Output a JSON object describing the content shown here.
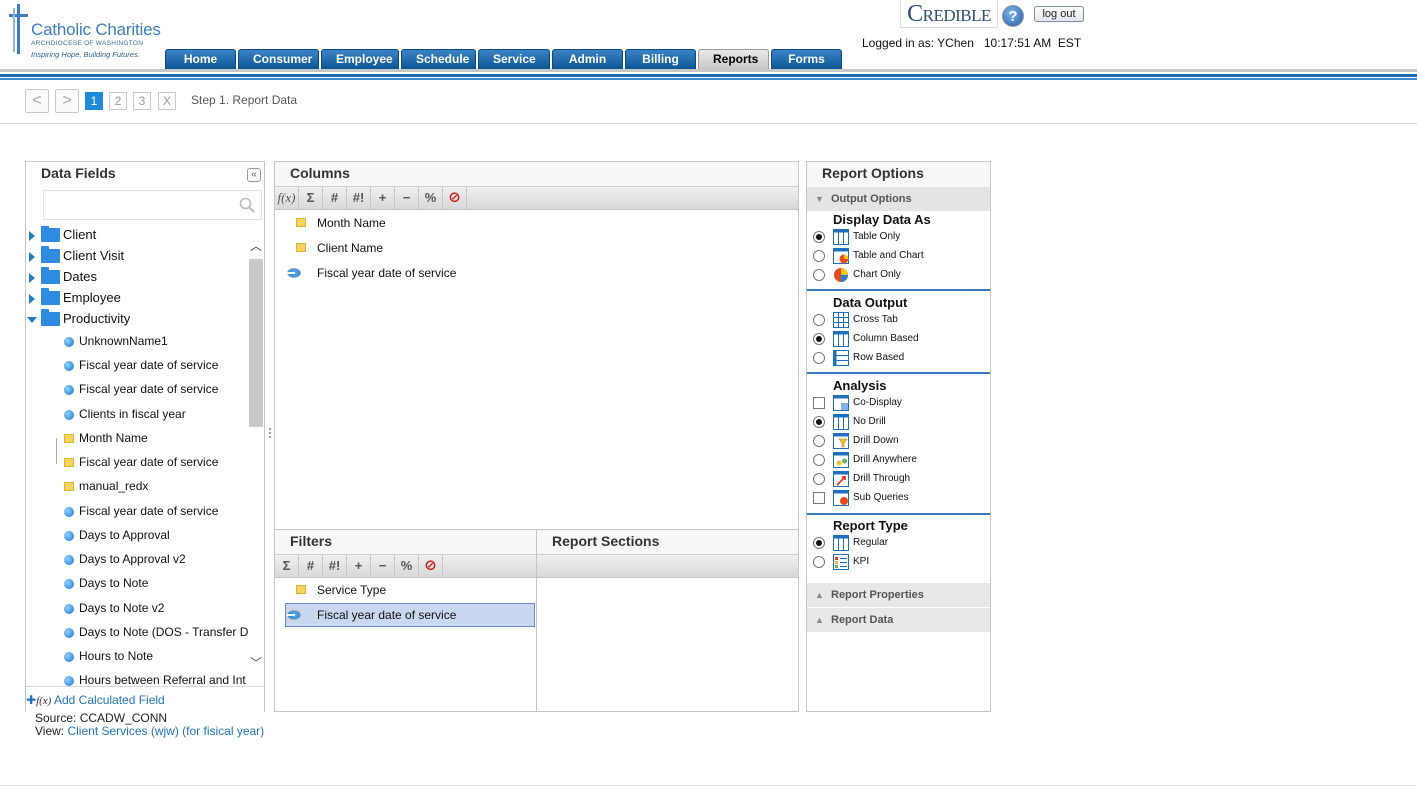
{
  "logo": {
    "line1": "Catholic Charities",
    "line2": "ARCHDIOCESE OF WASHINGTON",
    "line3": "Inspiring Hope, Building Futures."
  },
  "nav": {
    "tabs": [
      "Home",
      "Consumer",
      "Employee",
      "Schedule",
      "Service",
      "Admin",
      "Billing",
      "Reports",
      "Forms"
    ],
    "active": "Reports"
  },
  "header": {
    "brand": "Credible",
    "help": "?",
    "logout": "log out",
    "logged_in": "Logged in as: YChen   10:17:51 AM  EST"
  },
  "wizard": {
    "prev": "<",
    "next": ">",
    "steps": [
      "1",
      "2",
      "3",
      "X"
    ],
    "active_step": "1",
    "label": "Step 1. Report Data"
  },
  "data_fields": {
    "title": "Data Fields",
    "collapse": "«",
    "search_placeholder": "",
    "folders": [
      "Client",
      "Client Visit",
      "Dates",
      "Employee",
      "Productivity"
    ],
    "items": [
      {
        "label": "UnknownName1",
        "kind": "measure"
      },
      {
        "label": "Fiscal year date of service",
        "kind": "measure"
      },
      {
        "label": "Fiscal year date of service",
        "kind": "measure"
      },
      {
        "label": "Clients in fiscal year",
        "kind": "measure"
      },
      {
        "label": "Month Name",
        "kind": "dimension"
      },
      {
        "label": "Fiscal year date of service",
        "kind": "dimension"
      },
      {
        "label": "manual_redx",
        "kind": "dimension"
      },
      {
        "label": "Fiscal year date of service",
        "kind": "measure"
      },
      {
        "label": "Days to Approval",
        "kind": "measure"
      },
      {
        "label": "Days to Approval v2",
        "kind": "measure"
      },
      {
        "label": "Days to Note",
        "kind": "measure"
      },
      {
        "label": "Days to Note v2",
        "kind": "measure"
      },
      {
        "label": "Days to Note (DOS - Transfer D",
        "kind": "measure"
      },
      {
        "label": "Hours to Note",
        "kind": "measure"
      },
      {
        "label": "Hours between Referral and Int",
        "kind": "measure"
      }
    ],
    "add_calc": "Add Calculated Field",
    "add_calc_fx": "f(x)",
    "source": "Source: CCADW_CONN",
    "view_prefix": "View: ",
    "view_link": "Client Services (wjw) (for fisical year)"
  },
  "columns": {
    "title": "Columns",
    "toolbar": [
      "f(x)",
      "Σ",
      "#",
      "#!",
      "+",
      "−",
      "%",
      "⊘"
    ],
    "items": [
      {
        "label": "Month Name",
        "kind": "dimension"
      },
      {
        "label": "Client Name",
        "kind": "dimension"
      },
      {
        "label": "Fiscal year date of service",
        "kind": "measure"
      }
    ]
  },
  "filters": {
    "title": "Filters",
    "toolbar": [
      "Σ",
      "#",
      "#!",
      "+",
      "−",
      "%",
      "⊘"
    ],
    "items": [
      {
        "label": "Service Type",
        "kind": "dimension"
      },
      {
        "label": "Fiscal year date of service",
        "kind": "measure"
      }
    ]
  },
  "sections": {
    "title": "Report Sections"
  },
  "report_options": {
    "title": "Report Options",
    "output_options": "Output Options",
    "display": {
      "title": "Display Data As",
      "options": [
        "Table Only",
        "Table and Chart",
        "Chart Only"
      ],
      "selected": "Table Only"
    },
    "output": {
      "title": "Data Output",
      "options": [
        "Cross Tab",
        "Column Based",
        "Row Based"
      ],
      "selected": "Column Based"
    },
    "analysis": {
      "title": "Analysis",
      "options": [
        "Co-Display",
        "No Drill",
        "Drill Down",
        "Drill Anywhere",
        "Drill Through",
        "Sub Queries"
      ],
      "selected": "No Drill"
    },
    "report_type": {
      "title": "Report Type",
      "options": [
        "Regular",
        "KPI"
      ],
      "selected": "Regular"
    },
    "report_properties": "Report Properties",
    "report_data": "Report Data"
  }
}
